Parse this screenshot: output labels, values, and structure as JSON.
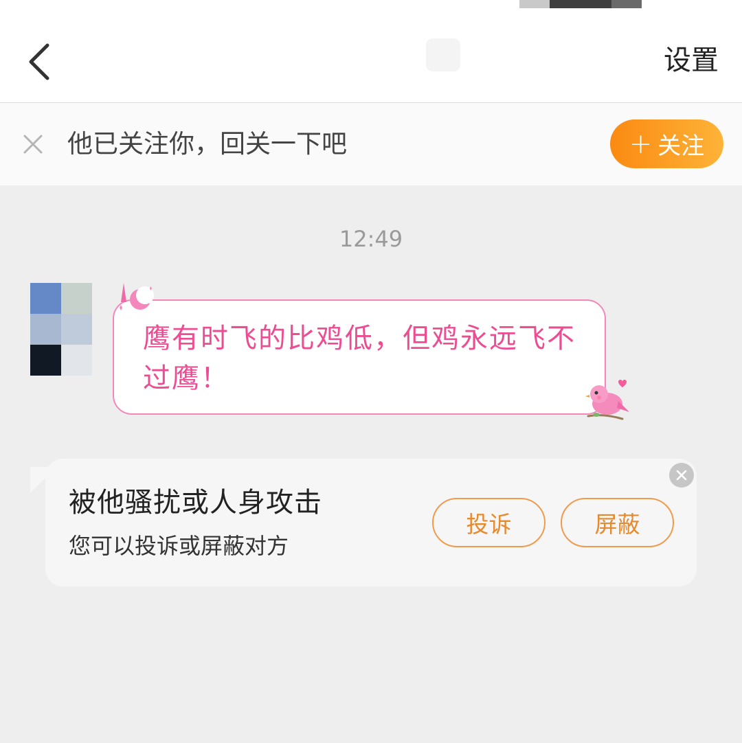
{
  "header": {
    "settings_label": "设置",
    "back_icon": "chevron-left-icon"
  },
  "follow_banner": {
    "message": "他已关注你，回关一下吧",
    "follow_label": "关注",
    "plus_glyph": "+",
    "close_icon": "close-icon"
  },
  "chat": {
    "timestamp": "12:49",
    "messages": [
      {
        "sender": "other",
        "text": "鹰有时飞的比鸡低，但鸡永远飞不过鹰！"
      }
    ]
  },
  "report_card": {
    "title": "被他骚扰或人身攻击",
    "subtitle": "您可以投诉或屏蔽对方",
    "complain_label": "投诉",
    "block_label": "屏蔽",
    "close_icon": "close-circle-icon"
  },
  "colors": {
    "accent_orange": "#fb8a12",
    "bubble_pink": "#ec4d92",
    "bubble_border": "#f486b9",
    "background": "#eeeeee"
  }
}
